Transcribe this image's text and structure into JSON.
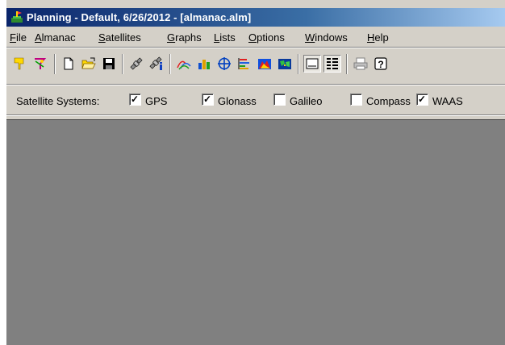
{
  "window": {
    "title": "Planning - Default, 6/26/2012 - [almanac.alm]"
  },
  "menu": [
    {
      "u": "F",
      "rest": "ile"
    },
    {
      "u": "A",
      "rest": "lmanac"
    },
    {
      "u": "S",
      "rest": "atellites"
    },
    {
      "u": "G",
      "rest": "raphs"
    },
    {
      "u": "L",
      "rest": "ists"
    },
    {
      "u": "O",
      "rest": "ptions"
    },
    {
      "u": "W",
      "rest": "indows"
    },
    {
      "u": "H",
      "rest": "elp"
    }
  ],
  "toolbar": {
    "icons": [
      "antenna-yellow-icon",
      "antenna-multicolor-icon",
      "new-file-icon",
      "open-folder-icon",
      "save-icon",
      "satellite-gray-icon",
      "satellite-info-icon",
      "elevation-graph-icon",
      "bar-chart-icon",
      "sky-plot-icon",
      "visibility-chart-icon",
      "world-map-icon",
      "world-map-detail-icon",
      "window-tiles-icon",
      "list-view-icon",
      "print-icon",
      "help-icon"
    ]
  },
  "satellite_systems": {
    "label": "Satellite Systems:",
    "items": [
      {
        "label": "GPS",
        "checked": true
      },
      {
        "label": "Glonass",
        "checked": true
      },
      {
        "label": "Galileo",
        "checked": false
      },
      {
        "label": "Compass",
        "checked": false
      },
      {
        "label": "WAAS",
        "checked": true
      }
    ]
  },
  "colors": {
    "titlebar_start": "#0a246a",
    "titlebar_end": "#a6caf0",
    "face": "#d4d0c8",
    "client": "#808080"
  }
}
